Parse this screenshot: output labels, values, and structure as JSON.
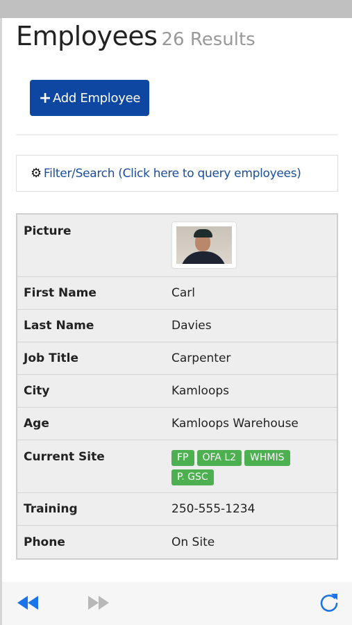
{
  "page": {
    "title": "Employees",
    "results": "26 Results"
  },
  "toolbar": {
    "add_label": "Add Employee",
    "add_icon": "plus-icon"
  },
  "filter": {
    "label": "Filter/Search (Click here to query employees)",
    "icon": "gear-icon"
  },
  "employee": {
    "picture_label": "Picture",
    "fields": [
      {
        "label": "First Name",
        "value": "Carl"
      },
      {
        "label": "Last Name",
        "value": "Davies"
      },
      {
        "label": "Job Title",
        "value": "Carpenter"
      },
      {
        "label": "City",
        "value": "Kamloops"
      },
      {
        "label": "Age",
        "value": "Kamloops Warehouse"
      }
    ],
    "site_label": "Current Site",
    "site_tags": [
      "FP",
      "OFA L2",
      "WHMIS",
      "P. GSC"
    ],
    "tag_color": "#4caf50",
    "fields2": [
      {
        "label": "Training",
        "value": "250-555-1234"
      },
      {
        "label": "Phone",
        "value": "On Site"
      }
    ]
  },
  "browser": {
    "back_icon": "rewind-icon",
    "forward_icon": "fast-forward-icon",
    "reload_icon": "reload-icon",
    "accent": "#1a73e8"
  }
}
